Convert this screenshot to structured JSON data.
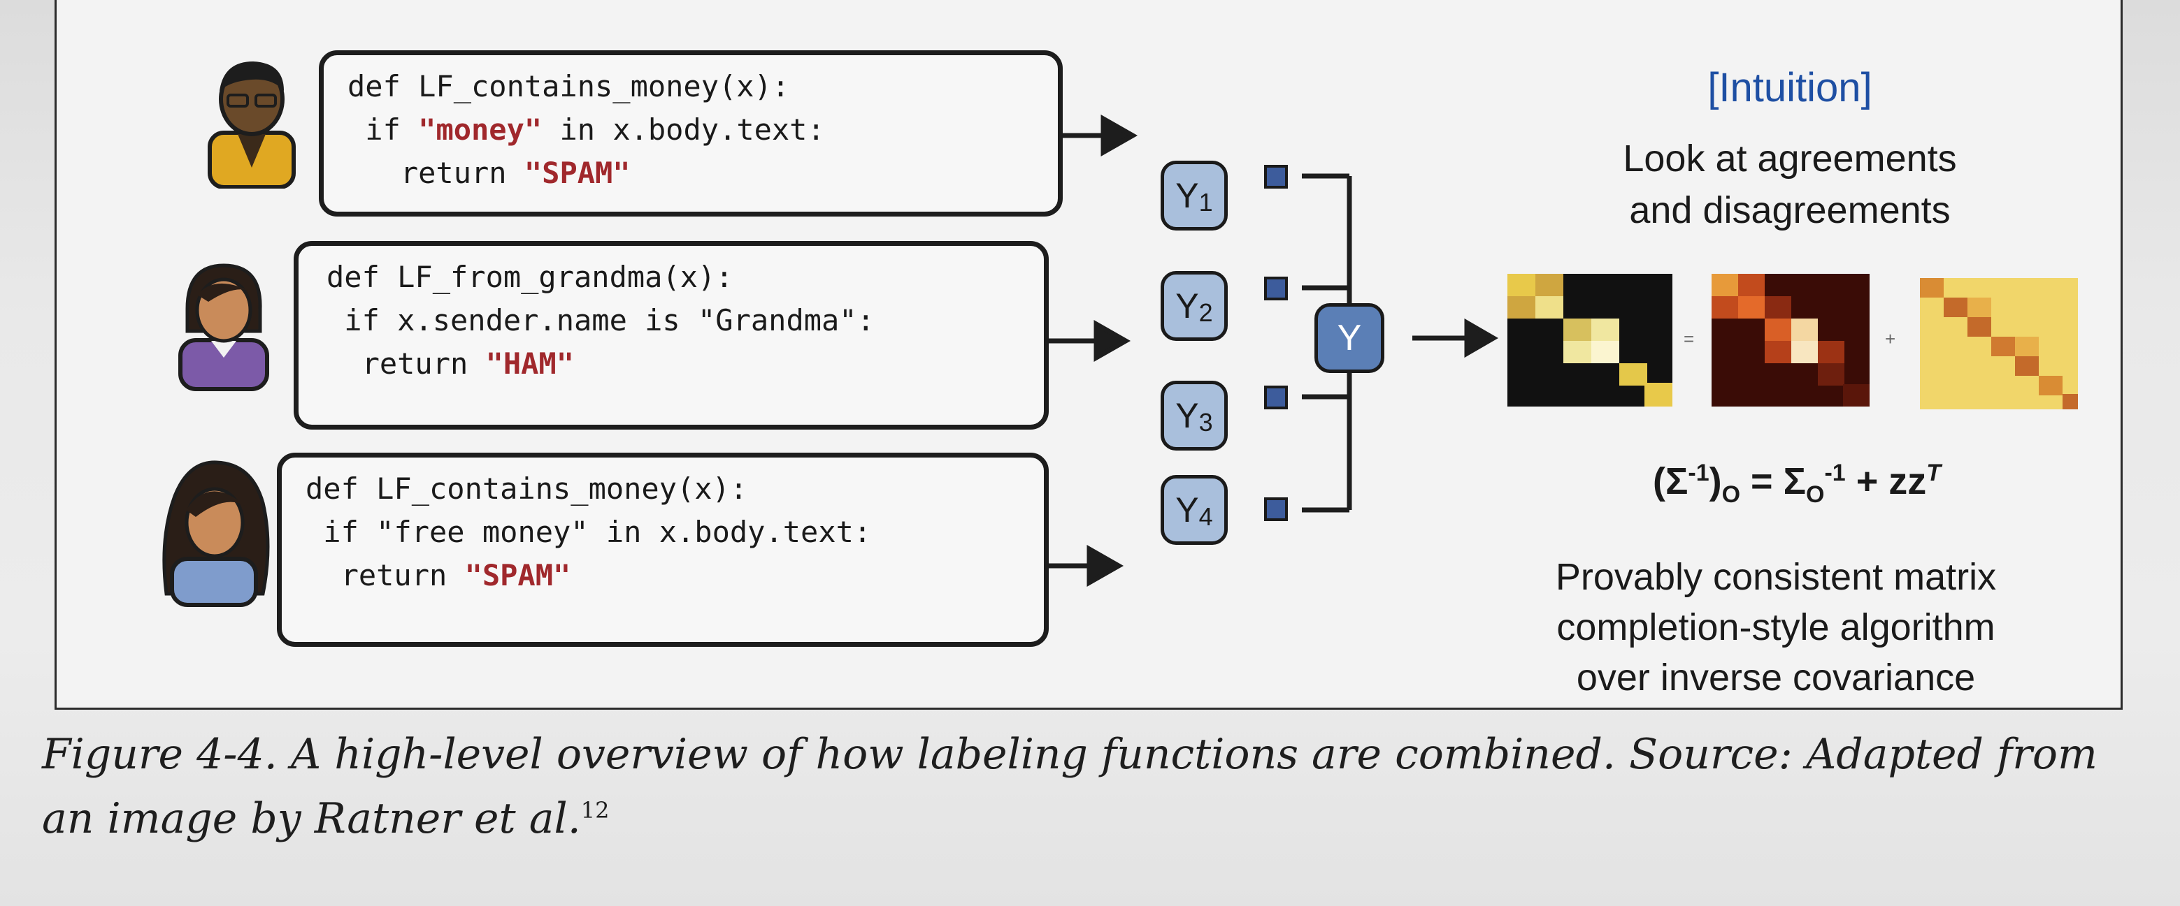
{
  "functions": [
    {
      "line1": "def LF_contains_money(x):",
      "line2_pre": " if ",
      "line2_str": "\"money\"",
      "line2_post": " in x.body.text:",
      "line3_pre": "   return ",
      "line3_str": "\"SPAM\""
    },
    {
      "line1": "def LF_from_grandma(x):",
      "line2_pre": " if x.sender.name is ",
      "line2_str": "\"Grandma\"",
      "line2_post": ":",
      "line3_pre": "  return ",
      "line3_str": "\"HAM\""
    },
    {
      "line1": "def LF_contains_money(x):",
      "line2_pre": " if ",
      "line2_str": "\"free money\"",
      "line2_post": " in x.body.text:",
      "line3_pre": "  return ",
      "line3_str": "\"SPAM\""
    }
  ],
  "nodes": [
    {
      "base": "Y",
      "sub": "1"
    },
    {
      "base": "Y",
      "sub": "2"
    },
    {
      "base": "Y",
      "sub": "3"
    },
    {
      "base": "Y",
      "sub": "4"
    }
  ],
  "combined_node": "Y",
  "intuition": {
    "title": "[Intuition]",
    "line1": "Look at agreements",
    "line2": "and disagreements"
  },
  "operators": {
    "eq": "=",
    "plus": "+"
  },
  "formula": {
    "lhs_open": "(Σ",
    "lhs_sup": "-1",
    "lhs_close": ")",
    "lhs_sub": "O",
    "eq": " = Σ",
    "rhs_sub": "O",
    "rhs_sup": "-1",
    "rhs_tail": " + zz",
    "rhs_tail_sup": "T"
  },
  "conclusion": {
    "line1": "Provably consistent matrix",
    "line2": "completion-style algorithm",
    "line3": "over inverse covariance"
  },
  "caption": {
    "text": "Figure 4-4. A high-level overview of how labeling functions are combined. Source: Adapted from an image by Ratner et al.",
    "footnote": "12"
  },
  "colors": {
    "string_red": "#a0282c",
    "node_fill": "#a9bfdc",
    "combined_fill": "#5b7fb6",
    "intuition_blue": "#1e4fa3",
    "avatar_gold": "#e0a822",
    "avatar_purple": "#7c5aa8",
    "avatar_blue": "#7f9ccc"
  }
}
